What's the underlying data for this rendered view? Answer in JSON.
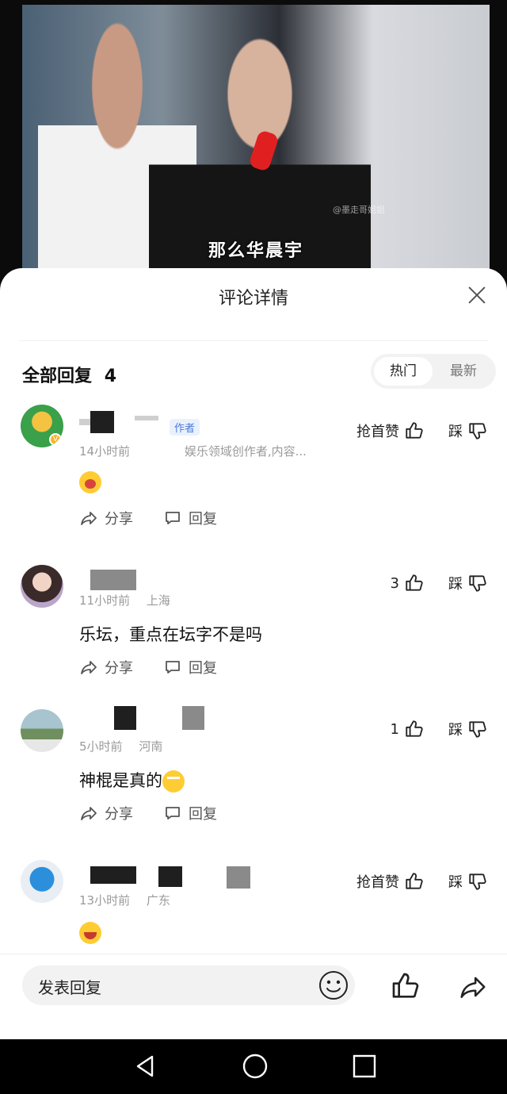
{
  "video": {
    "subtitle": "那么华晨宇",
    "watermark": "@墨走哥姐姐"
  },
  "sheet": {
    "title": "评论详情",
    "replies_label": "全部回复",
    "replies_count": "4",
    "sort": {
      "hot": "热门",
      "new": "最新"
    }
  },
  "comments": [
    {
      "tag": "作者",
      "time": "14小时前",
      "location": "娱乐领域创作者,内容...",
      "content_emoji": "crying-emoji",
      "like_label": "抢首赞",
      "dislike_label": "踩",
      "share_label": "分享",
      "reply_label": "回复"
    },
    {
      "time": "11小时前",
      "location": "上海",
      "content": "乐坛，重点在坛字不是吗",
      "like_count": "3",
      "dislike_label": "踩",
      "share_label": "分享",
      "reply_label": "回复"
    },
    {
      "time": "5小时前",
      "location": "河南",
      "content": "神棍是真的",
      "content_emoji": "eye-roll-emoji",
      "like_count": "1",
      "dislike_label": "踩",
      "share_label": "分享",
      "reply_label": "回复"
    },
    {
      "time": "13小时前",
      "location": "广东",
      "content_emoji": "laughing-emoji",
      "like_label": "抢首赞",
      "dislike_label": "踩"
    }
  ],
  "bottom_bar": {
    "placeholder": "发表回复"
  },
  "colors": {
    "author_tag": "#4b7bd6",
    "meta": "#9a9a9a"
  }
}
